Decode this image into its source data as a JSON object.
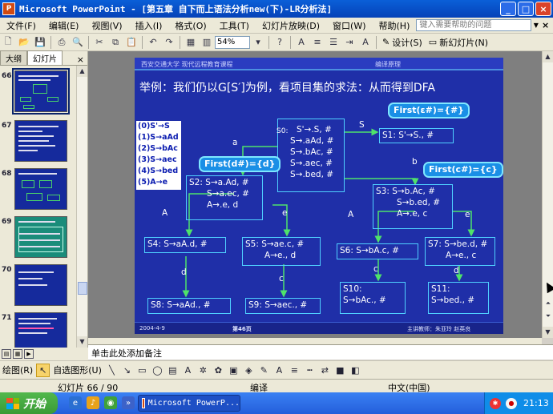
{
  "window": {
    "title": "Microsoft PowerPoint - [第五章 自下而上语法分析new(下)-LR分析法]",
    "app_icon_label": "P",
    "minimize": "_",
    "maximize": "□",
    "close": "×"
  },
  "menubar": {
    "items": [
      "文件(F)",
      "编辑(E)",
      "视图(V)",
      "插入(I)",
      "格式(O)",
      "工具(T)",
      "幻灯片放映(D)",
      "窗口(W)",
      "帮助(H)"
    ],
    "help_placeholder": "键入需要帮助的问题"
  },
  "toolbar": {
    "zoom": "54%",
    "design_label": "设计(S)",
    "new_slide_label": "新幻灯片(N)"
  },
  "left_pane": {
    "tab_outline": "大纲",
    "tab_slides": "幻灯片",
    "close": "×",
    "slide_numbers": [
      "66",
      "67",
      "68",
      "69",
      "70",
      "71"
    ],
    "selected": "66"
  },
  "slide": {
    "header_school": "西安交通大学 现代远程教育课程",
    "header_course": "编译原理",
    "heading": "举例：我们仍以G[S′]为例，看项目集的求法：从而得到DFA",
    "rules": [
      "(0)S'→S",
      "(1)S→aAd",
      "(2)S→bAc",
      "(3)S→aec",
      "(4)S→bed",
      "(5)A→e"
    ],
    "s0": {
      "title": "S0:",
      "items": [
        "S'→.S, #",
        "S→.aAd, #",
        "S→.bAc, #",
        "S→.aec, #",
        "S→.bed, #"
      ]
    },
    "s1": "S1: S'→S., #",
    "s2": [
      "S2: S→a.Ad, #",
      "S→a.ec, #",
      "A→.e, d"
    ],
    "s3": [
      "S3: S→b.Ac, #",
      "S→b.ed, #",
      "A→.e, c"
    ],
    "s4": "S4: S→aA.d, #",
    "s5": [
      "S5: S→ae.c, #",
      "A→e., d"
    ],
    "s6": "S6: S→bA.c, #",
    "s7": [
      "S7: S→be.d, #",
      "A→e., c"
    ],
    "s8": "S8: S→aAd., #",
    "s9": "S9: S→aec., #",
    "s10": [
      "S10:",
      "S→bAc., #"
    ],
    "s11": [
      "S11:",
      "S→bed., #"
    ],
    "callout_first_e": "First(ε#)={#}",
    "callout_first_d": "First(d#)={d}",
    "callout_first_c": "First(c#)={c}",
    "edge_labels": {
      "S": "S",
      "a": "a",
      "b": "b",
      "A_left": "A",
      "e_left": "e",
      "A_right": "A",
      "e_right": "e",
      "d_left": "d",
      "c_left": "c",
      "c_right": "c",
      "d_right": "d"
    },
    "footer_date": "2004-4-9",
    "footer_page": "第46页",
    "footer_author": "主讲教师：朱亚玲 赵英良"
  },
  "notes_placeholder": "单击此处添加备注",
  "drawing_toolbar": {
    "draw_label": "绘图(R)",
    "autoshapes_label": "自选图形(U)"
  },
  "statusbar": {
    "slide_info": "幻灯片 66 / 90",
    "design": "编译",
    "language": "中文(中国)"
  },
  "taskbar": {
    "start_label": "开始",
    "task_label": "Microsoft PowerP...",
    "clock": "21:13"
  }
}
